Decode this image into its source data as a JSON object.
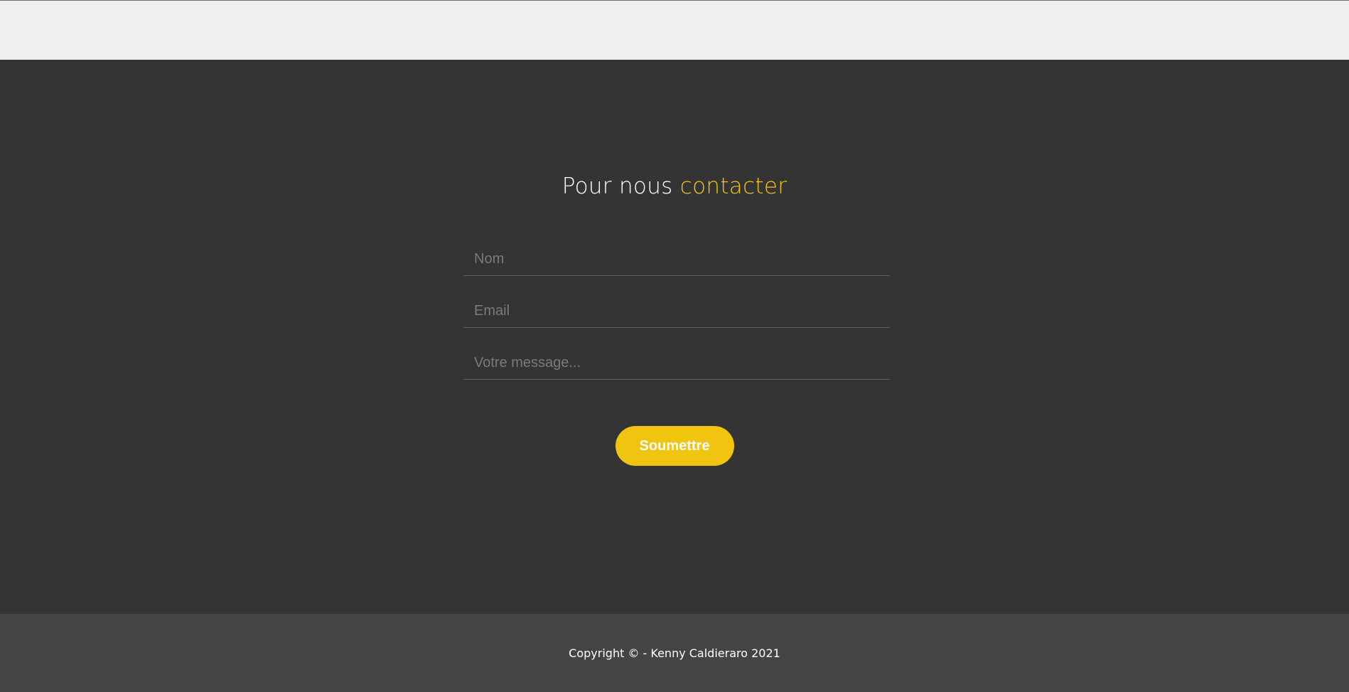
{
  "colors": {
    "accent": "#f1c40f",
    "background": "#343434",
    "top_bar": "#efefef",
    "footer": "#444444"
  },
  "contact": {
    "title_part1": "Pour nous ",
    "title_part2": "contacter",
    "fields": {
      "name_placeholder": "Nom",
      "email_placeholder": "Email",
      "message_placeholder": "Votre message..."
    },
    "submit_label": "Soumettre"
  },
  "footer": {
    "copyright": "Copyright © - Kenny Caldieraro 2021"
  }
}
